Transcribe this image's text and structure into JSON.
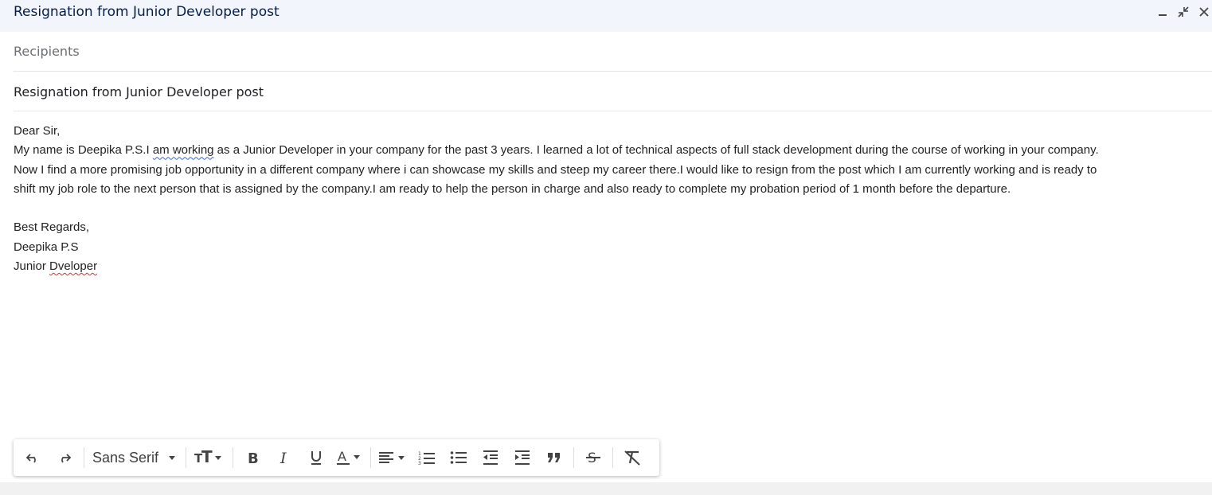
{
  "window": {
    "title": "Resignation from Junior Developer post"
  },
  "fields": {
    "recipients_placeholder": "Recipients",
    "subject_value": "Resignation from Junior Developer post"
  },
  "body": {
    "greeting": "Dear Sir,",
    "p1_a": "My name is Deepika P.S.I ",
    "p1_spell": "am working",
    "p1_b": " as a Junior Developer in your company for the past 3 years. I learned a lot of technical aspects of full stack development during the course of working in your company.",
    "p2": "Now I find a more promising job opportunity in a different company where i can showcase my skills and steep my career there.I would like to resign from the post which I am currently working and is ready to",
    "p3": "shift my job role to the next person that is assigned by the company.I am ready to help the person in charge and also ready to complete my probation period of 1 month before the departure.",
    "closing": "Best Regards,",
    "sender_name": "Deepika P.S",
    "sender_title_a": "Junior ",
    "sender_title_spell": "Dveloper"
  },
  "toolbar": {
    "font": "Sans Serif",
    "icons": [
      "undo-icon",
      "redo-icon",
      "font-family-select",
      "text-size-icon",
      "bold-icon",
      "italic-icon",
      "underline-icon",
      "text-color-icon",
      "align-icon",
      "numbered-list-icon",
      "bulleted-list-icon",
      "indent-less-icon",
      "indent-more-icon",
      "quote-icon",
      "strikethrough-icon",
      "remove-formatting-icon"
    ]
  },
  "titlebar_icons": [
    "minimize-icon",
    "exit-fullscreen-icon",
    "close-icon"
  ]
}
